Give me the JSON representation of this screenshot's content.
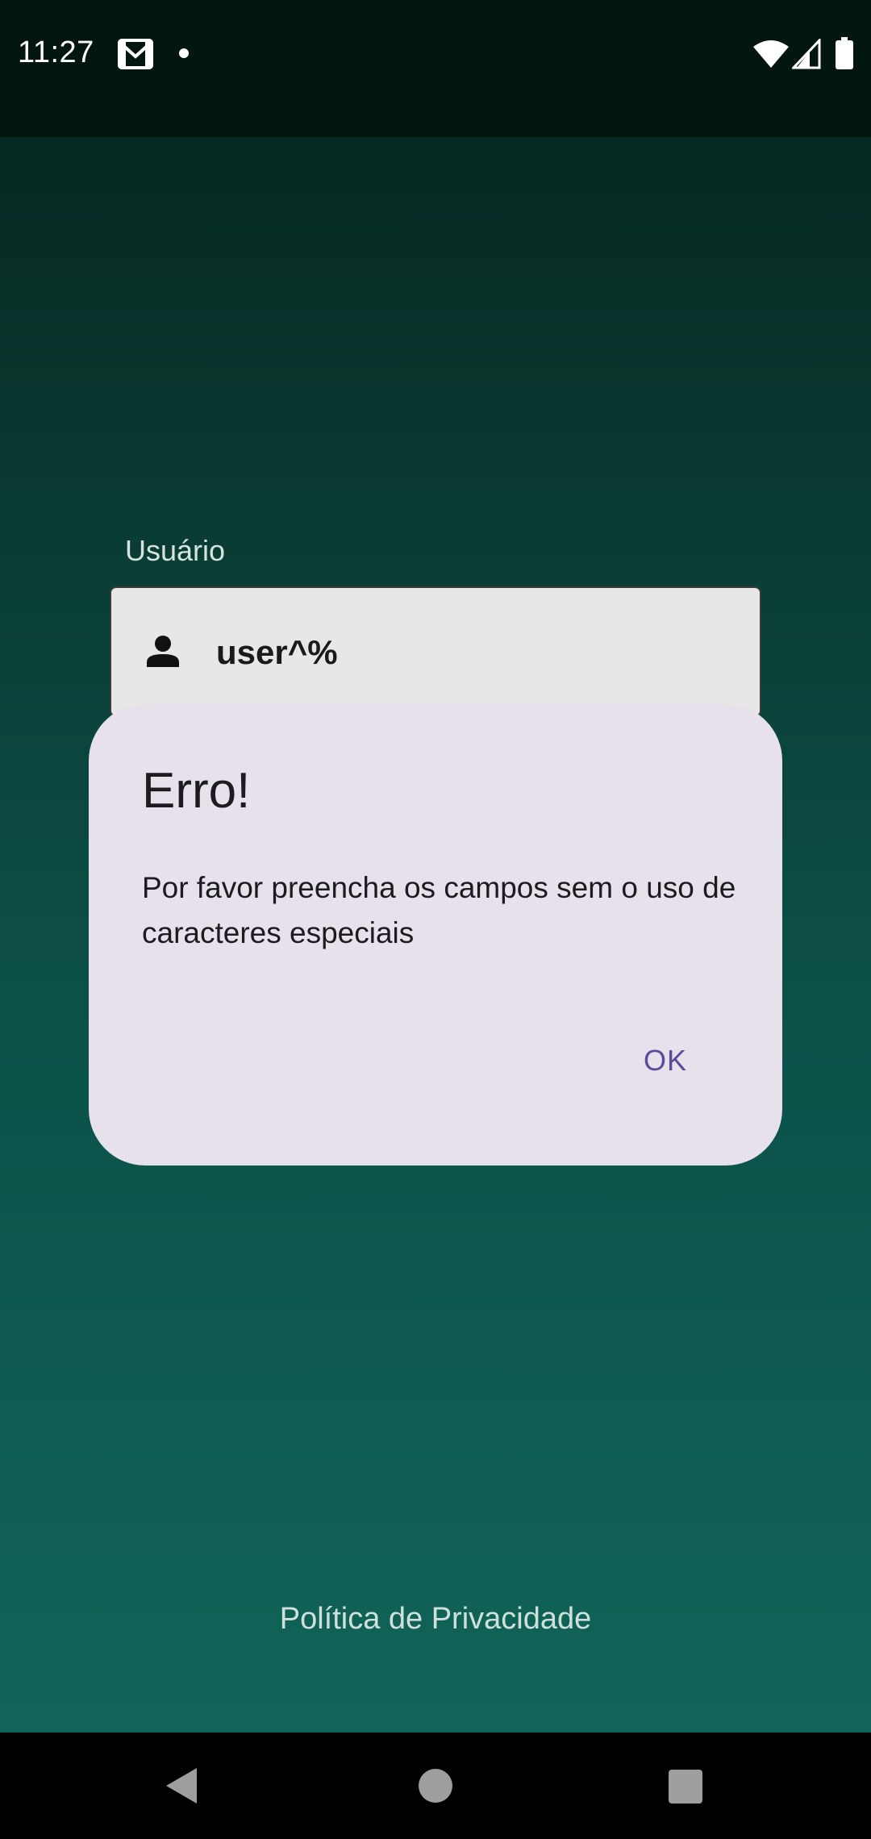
{
  "status_bar": {
    "time": "11:27",
    "icons": [
      "gmail-icon",
      "notification-dot-icon",
      "wifi-icon",
      "signal-icon",
      "battery-icon"
    ]
  },
  "login": {
    "user_label": "Usuário",
    "user_value": "user^%",
    "user_icon": "person-icon"
  },
  "dialog": {
    "title": "Erro!",
    "message": "Por favor preencha os campos sem o uso de caracteres especiais",
    "ok_label": "OK"
  },
  "footer": {
    "privacy_link": "Política de Privacidade"
  },
  "nav_bar": {
    "icons": [
      "back-icon",
      "home-icon",
      "recents-icon"
    ]
  },
  "colors": {
    "background_top": "#04221b",
    "background_bottom": "#106459",
    "dialog_bg": "#e6e1ea",
    "accent": "#5e4a9a"
  }
}
